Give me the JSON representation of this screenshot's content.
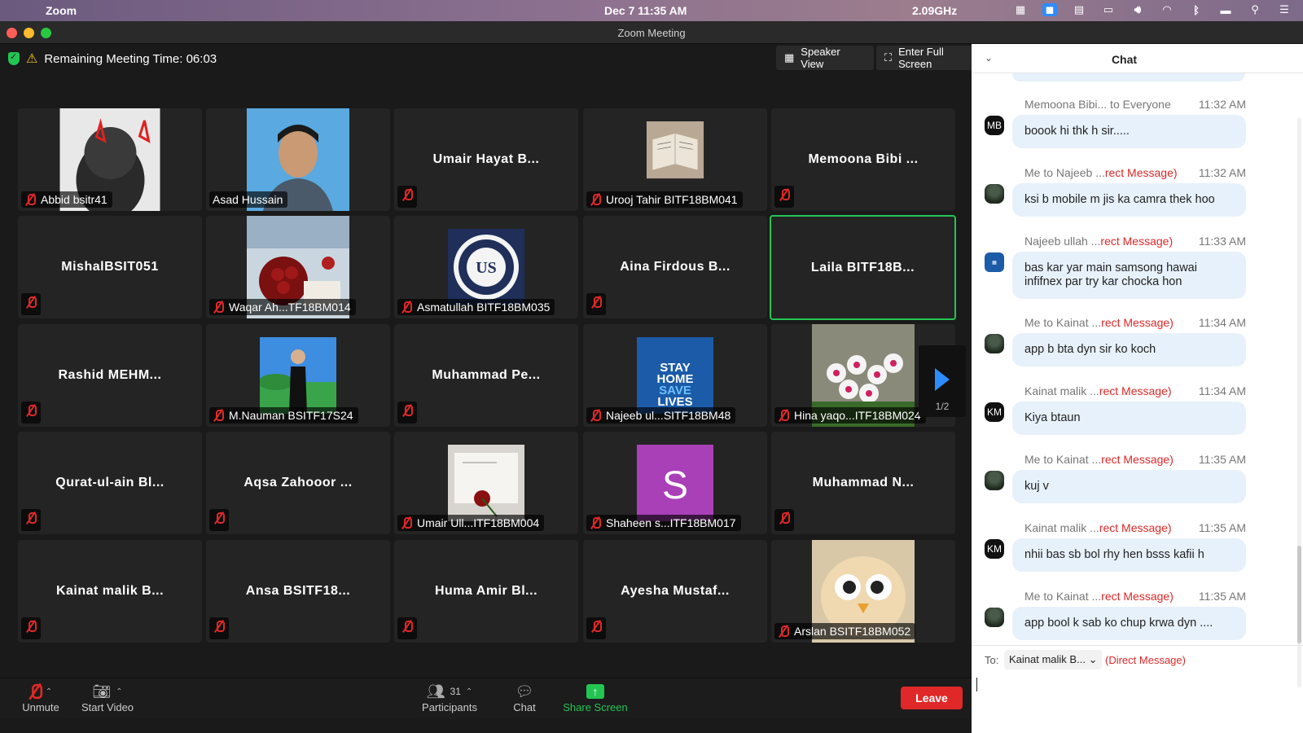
{
  "menubar": {
    "app_name": "Zoom",
    "clock": "Dec 7  11:35 AM",
    "cpu": "2.09GHz"
  },
  "window": {
    "title": "Zoom Meeting"
  },
  "meeting": {
    "remaining_time": "Remaining Meeting Time: 06:03",
    "speaker_view": "Speaker View",
    "full_screen": "Enter Full Screen",
    "page_indicator": "1/2"
  },
  "tiles": [
    {
      "name": "Abbid bsitr41",
      "has_video": true
    },
    {
      "name": "Asad Hussain",
      "has_video": true
    },
    {
      "name": "Umair Hayat B...",
      "has_video": false
    },
    {
      "name": "Urooj Tahir BITF18BM041",
      "has_video": true
    },
    {
      "name": "Memoona Bibi ...",
      "has_video": false
    },
    {
      "name": "MishalBSIT051",
      "has_video": false
    },
    {
      "name": "Waqar Ah...TF18BM014",
      "has_video": true
    },
    {
      "name": "Asmatullah BITF18BM035",
      "has_video": true
    },
    {
      "name": "Aina Firdous B...",
      "has_video": false
    },
    {
      "name": "Laila BITF18B...",
      "has_video": false
    },
    {
      "name": "Rashid MEHM...",
      "has_video": false
    },
    {
      "name": "M.Nauman BSITF17S24",
      "has_video": true
    },
    {
      "name": "Muhammad Pe...",
      "has_video": false
    },
    {
      "name": "Najeeb ul...SITF18BM48",
      "has_video": true
    },
    {
      "name": "Hina yaqo...ITF18BM024",
      "has_video": true
    },
    {
      "name": "Qurat-ul-ain Bl...",
      "has_video": false
    },
    {
      "name": "Aqsa Zahooor ...",
      "has_video": false
    },
    {
      "name": "Umair Ull...ITF18BM004",
      "has_video": true
    },
    {
      "name": "Shaheen s...ITF18BM017",
      "has_video": true
    },
    {
      "name": "Muhammad N...",
      "has_video": false
    },
    {
      "name": "Kainat malik B...",
      "has_video": false
    },
    {
      "name": "Ansa BSITF18...",
      "has_video": false
    },
    {
      "name": "Huma Amir Bl...",
      "has_video": false
    },
    {
      "name": "Ayesha Mustaf...",
      "has_video": false
    },
    {
      "name": "Arslan BSITF18BM052",
      "has_video": true
    }
  ],
  "photo_text": {
    "univ_logo": "US",
    "stay_home": "STAY HOME SAVE LIVES",
    "shaheen_letter": "S"
  },
  "toolbar": {
    "unmute": "Unmute",
    "start_video": "Start Video",
    "participants": "Participants",
    "participant_count": "31",
    "chat": "Chat",
    "share_screen": "Share Screen",
    "leave": "Leave"
  },
  "chat": {
    "title": "Chat",
    "messages": [
      {
        "sender": "Memoona Bibi... to Everyone",
        "dm": "",
        "time": "11:32 AM",
        "avatar": "MB",
        "text": "boook hi thk h sir....."
      },
      {
        "sender": "Me to Najeeb ...",
        "dm": "rect Message)",
        "time": "11:32 AM",
        "avatar": "",
        "text": "ksi b mobile m jis ka camra thek hoo"
      },
      {
        "sender": "Najeeb ullah ...",
        "dm": "rect Message)",
        "time": "11:33 AM",
        "avatar": "",
        "text": "bas kar yar main samsong hawai infifnex par try kar chocka hon"
      },
      {
        "sender": "Me to Kainat ...",
        "dm": "rect Message)",
        "time": "11:34 AM",
        "avatar": "",
        "text": "app b bta dyn sir ko koch"
      },
      {
        "sender": "Kainat malik ...",
        "dm": "rect Message)",
        "time": "11:34 AM",
        "avatar": "KM",
        "text": "Kiya btaun"
      },
      {
        "sender": "Me to Kainat ...",
        "dm": "rect Message)",
        "time": "11:35 AM",
        "avatar": "",
        "text": "kuj v"
      },
      {
        "sender": "Kainat malik ...",
        "dm": "rect Message)",
        "time": "11:35 AM",
        "avatar": "KM",
        "text": "nhii bas sb bol rhy hen bsss kafii h"
      },
      {
        "sender": "Me to Kainat ...",
        "dm": "rect Message)",
        "time": "11:35 AM",
        "avatar": "",
        "text": "app bool k sab ko chup krwa dyn ...."
      }
    ],
    "to_label": "To:",
    "recipient": "Kainat malik B...",
    "direct_message": "(Direct Message)"
  }
}
